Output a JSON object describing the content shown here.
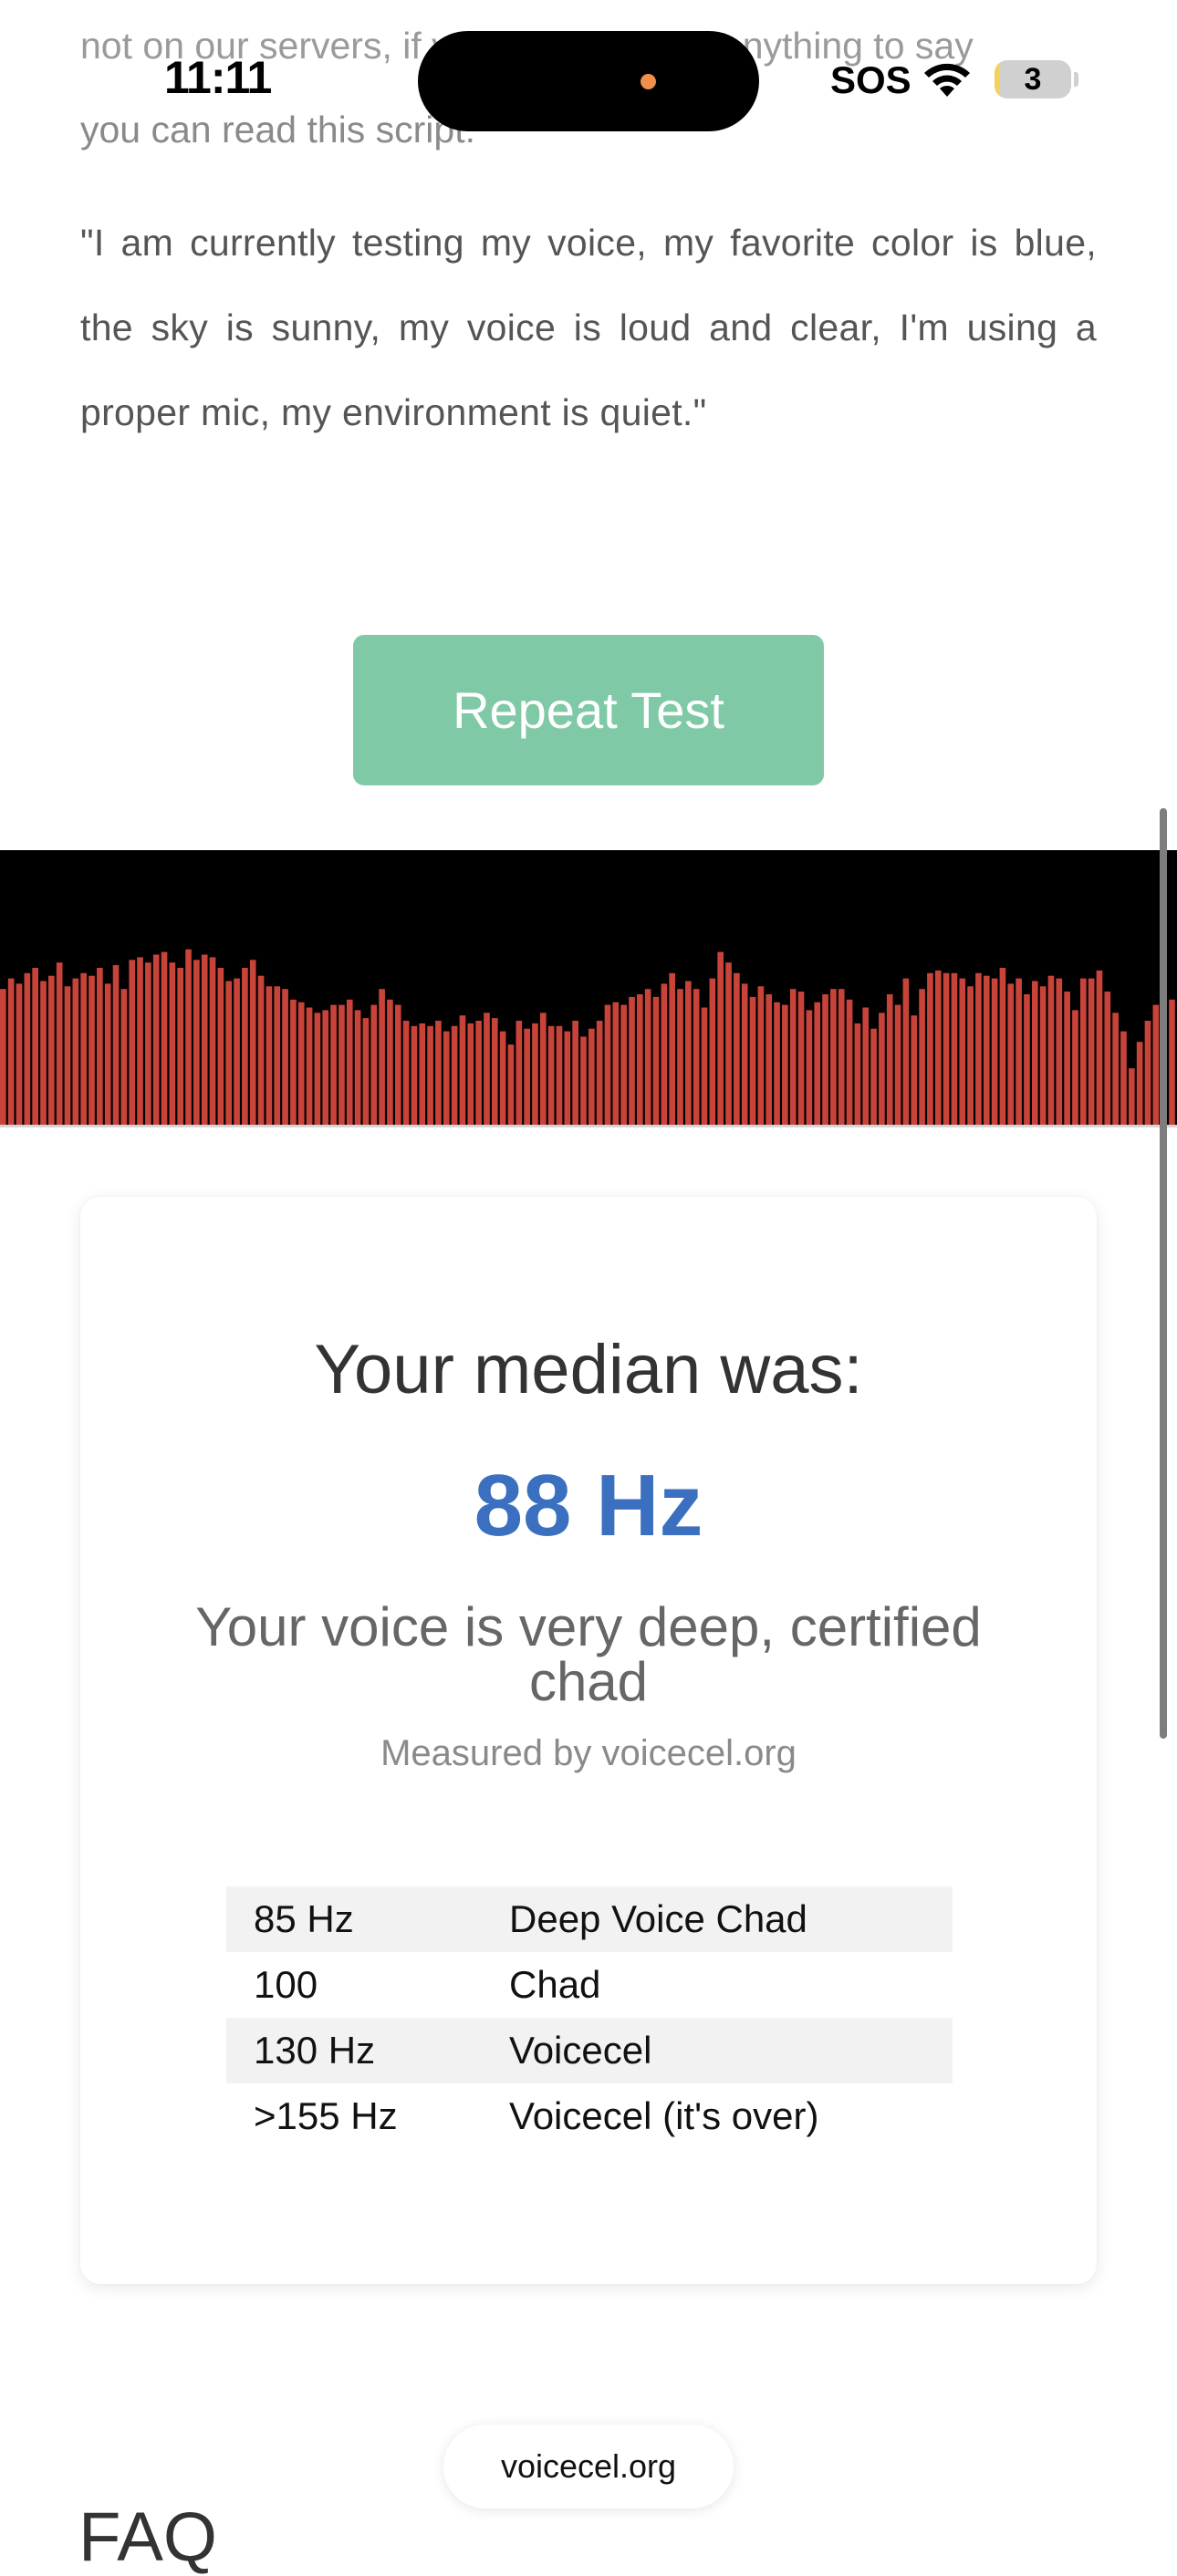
{
  "status_bar": {
    "time": "11:11",
    "sos": "SOS",
    "battery_level": "3",
    "battery_fraction": 0.03,
    "icons": [
      "wifi-icon",
      "battery-icon"
    ]
  },
  "intro": {
    "faded_line1": "not on our servers, if you can't think of anything to say",
    "faded_line2": "you can read this script:",
    "sample_script": "\"I am currently testing my voice, my favorite color is blue, the sky is sunny, my voice is loud and clear, I'm using a proper mic, my environment is quiet.\""
  },
  "actions": {
    "repeat_label": "Repeat Test"
  },
  "waveform": {
    "bar_color": "#c8443a",
    "background": "#000000",
    "amplitudes": [
      0.52,
      0.56,
      0.54,
      0.58,
      0.6,
      0.55,
      0.57,
      0.62,
      0.53,
      0.56,
      0.58,
      0.57,
      0.6,
      0.54,
      0.61,
      0.52,
      0.63,
      0.64,
      0.62,
      0.65,
      0.66,
      0.62,
      0.6,
      0.67,
      0.63,
      0.65,
      0.64,
      0.6,
      0.55,
      0.56,
      0.6,
      0.63,
      0.57,
      0.53,
      0.53,
      0.52,
      0.48,
      0.47,
      0.45,
      0.43,
      0.44,
      0.46,
      0.46,
      0.48,
      0.44,
      0.41,
      0.46,
      0.52,
      0.48,
      0.46,
      0.4,
      0.38,
      0.39,
      0.38,
      0.4,
      0.36,
      0.38,
      0.42,
      0.39,
      0.4,
      0.43,
      0.41,
      0.36,
      0.31,
      0.4,
      0.37,
      0.39,
      0.43,
      0.38,
      0.38,
      0.36,
      0.4,
      0.34,
      0.37,
      0.4,
      0.46,
      0.47,
      0.46,
      0.49,
      0.5,
      0.52,
      0.49,
      0.54,
      0.58,
      0.52,
      0.55,
      0.52,
      0.45,
      0.56,
      0.66,
      0.62,
      0.58,
      0.54,
      0.49,
      0.53,
      0.5,
      0.47,
      0.46,
      0.52,
      0.51,
      0.44,
      0.47,
      0.5,
      0.52,
      0.52,
      0.48,
      0.39,
      0.45,
      0.37,
      0.43,
      0.5,
      0.46,
      0.56,
      0.42,
      0.52,
      0.58,
      0.59,
      0.58,
      0.58,
      0.56,
      0.53,
      0.58,
      0.57,
      0.56,
      0.6,
      0.54,
      0.56,
      0.5,
      0.55,
      0.53,
      0.57,
      0.56,
      0.51,
      0.44,
      0.56,
      0.56,
      0.59,
      0.51,
      0.43,
      0.36,
      0.22,
      0.32,
      0.4,
      0.46,
      0.4,
      0.48
    ]
  },
  "result": {
    "median_label": "Your median was:",
    "median_value": "88 Hz",
    "verdict": "Your voice is very deep, certified chad",
    "measured_by": "Measured by voicecel.org",
    "value_color": "#3b6fc0",
    "reference_table": [
      {
        "frequency": "85 Hz",
        "label": "Deep Voice Chad"
      },
      {
        "frequency": "100",
        "label": "Chad"
      },
      {
        "frequency": "130 Hz",
        "label": "Voicecel"
      },
      {
        "frequency": ">155 Hz",
        "label": "Voicecel (it's over)"
      }
    ]
  },
  "footer": {
    "url": "voicecel.org",
    "faq_heading": "FAQ"
  },
  "colors": {
    "accent_button": "#80c9a6",
    "text_body": "#555555"
  }
}
